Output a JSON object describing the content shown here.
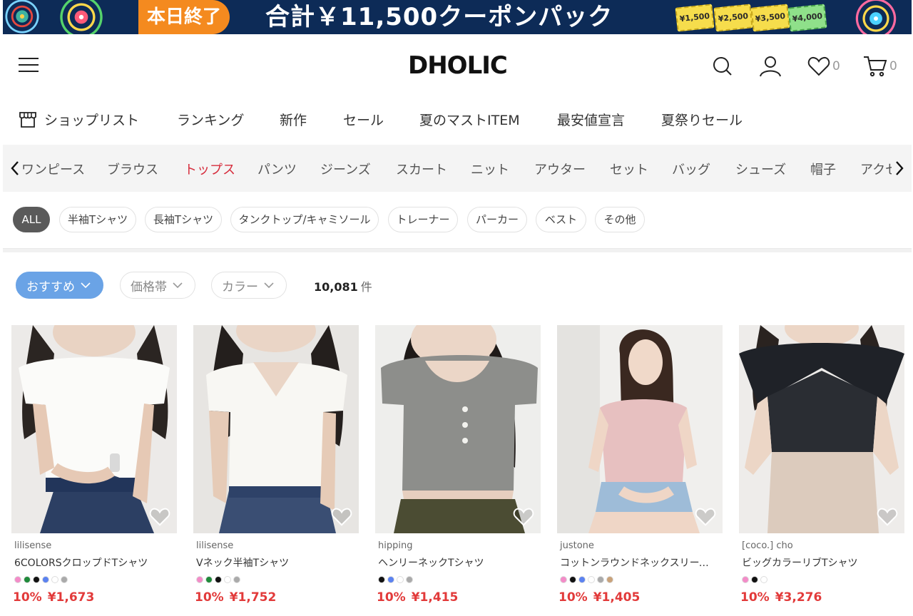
{
  "banner": {
    "tag": "本日終了",
    "headline": "合計￥11,500クーポンパック",
    "coupons": [
      "¥1,500",
      "¥2,500",
      "¥3,500",
      "¥4,000"
    ]
  },
  "header": {
    "logo": "DHOLIC",
    "wishlist_count": "0",
    "cart_count": "0"
  },
  "main_nav": [
    "ショップリスト",
    "ランキング",
    "新作",
    "セール",
    "夏のマストITEM",
    "最安値宣言",
    "夏祭りセール"
  ],
  "categories": [
    "ワンピース",
    "ブラウス",
    "トップス",
    "パンツ",
    "ジーンズ",
    "スカート",
    "ニット",
    "アウター",
    "セット",
    "バッグ",
    "シューズ",
    "帽子",
    "アクセ"
  ],
  "active_category": "トップス",
  "sub_chips": [
    "ALL",
    "半袖Tシャツ",
    "長袖Tシャツ",
    "タンクトップ/キャミソール",
    "トレーナー",
    "パーカー",
    "ベスト",
    "その他"
  ],
  "filters": {
    "sort": "おすすめ",
    "price": "価格帯",
    "color": "カラー",
    "count": "10,081",
    "count_unit": "件"
  },
  "products": [
    {
      "brand": "lilisense",
      "name": "6COLORSクロップドTシャツ",
      "discount": "10%",
      "price": "¥1,673",
      "swatches": [
        "#f38cc8",
        "#1f8a3a",
        "#111111",
        "#5b82f0",
        "#ffffff",
        "#aaaaaa"
      ]
    },
    {
      "brand": "lilisense",
      "name": "Vネック半袖Tシャツ",
      "discount": "10%",
      "price": "¥1,752",
      "swatches": [
        "#f38cc8",
        "#1f8a3a",
        "#111111",
        "#ffffff",
        "#aaaaaa"
      ]
    },
    {
      "brand": "hipping",
      "name": "ヘンリーネックTシャツ",
      "discount": "10%",
      "price": "¥1,415",
      "swatches": [
        "#111111",
        "#5b82f0",
        "#ffffff",
        "#aaaaaa"
      ]
    },
    {
      "brand": "justone",
      "name": "コットンラウンドネックスリーブレスTシャツ",
      "discount": "10%",
      "price": "¥1,405",
      "swatches": [
        "#f38cc8",
        "#111111",
        "#5b82f0",
        "#ffffff",
        "#aaaaaa",
        "#c9a27a"
      ]
    },
    {
      "brand": "[coco.] cho",
      "name": "ビッグカラーリブTシャツ",
      "discount": "10%",
      "price": "¥3,276",
      "swatches": [
        "#f38cc8",
        "#111111",
        "#ffffff"
      ]
    }
  ]
}
